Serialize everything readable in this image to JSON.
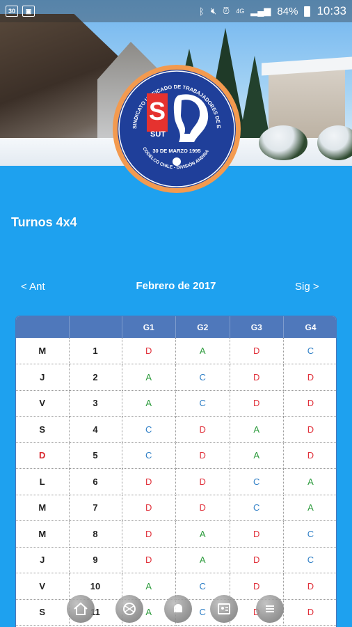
{
  "status_bar": {
    "left_icons": [
      "30",
      "image-icon"
    ],
    "right_icons": [
      "bluetooth-icon",
      "mute-icon",
      "alarm-icon",
      "4g-icon",
      "signal-icon"
    ],
    "battery": "84%",
    "time": "10:33"
  },
  "logo": {
    "arc_text": "SINDICATO UNIFICADO DE TRABAJADORES DE EMPRESA",
    "initials": "SUT",
    "date": "30 DE MARZO 1995",
    "bottom_text": "CODELCO CHILE - DIVISIÓN ANDINA"
  },
  "page": {
    "title": "Turnos 4x4",
    "prev": "< Ant",
    "next": "Sig >",
    "month": "Febrero de 2017"
  },
  "table": {
    "headers": [
      "",
      "",
      "G1",
      "G2",
      "G3",
      "G4"
    ],
    "rows": [
      {
        "day": "M",
        "num": "1",
        "g": [
          "D",
          "A",
          "D",
          "C"
        ]
      },
      {
        "day": "J",
        "num": "2",
        "g": [
          "A",
          "C",
          "D",
          "D"
        ]
      },
      {
        "day": "V",
        "num": "3",
        "g": [
          "A",
          "C",
          "D",
          "D"
        ]
      },
      {
        "day": "S",
        "num": "4",
        "g": [
          "C",
          "D",
          "A",
          "D"
        ]
      },
      {
        "day": "D",
        "num": "5",
        "g": [
          "C",
          "D",
          "A",
          "D"
        ]
      },
      {
        "day": "L",
        "num": "6",
        "g": [
          "D",
          "D",
          "C",
          "A"
        ]
      },
      {
        "day": "M",
        "num": "7",
        "g": [
          "D",
          "D",
          "C",
          "A"
        ]
      },
      {
        "day": "M",
        "num": "8",
        "g": [
          "D",
          "A",
          "D",
          "C"
        ]
      },
      {
        "day": "J",
        "num": "9",
        "g": [
          "D",
          "A",
          "D",
          "C"
        ]
      },
      {
        "day": "V",
        "num": "10",
        "g": [
          "A",
          "C",
          "D",
          "D"
        ]
      },
      {
        "day": "S",
        "num": "11",
        "g": [
          "A",
          "C",
          "D",
          "D"
        ]
      }
    ]
  },
  "colors": {
    "background": "#1ea1ef",
    "header_row": "#4f78bb",
    "shift_D": "#e0303a",
    "shift_A": "#2c9b3c",
    "shift_C": "#2f7fc6",
    "sunday": "#d8262c"
  },
  "bottom_nav": [
    "home-icon",
    "map-icon",
    "bell-icon",
    "contact-card-icon",
    "menu-icon"
  ]
}
